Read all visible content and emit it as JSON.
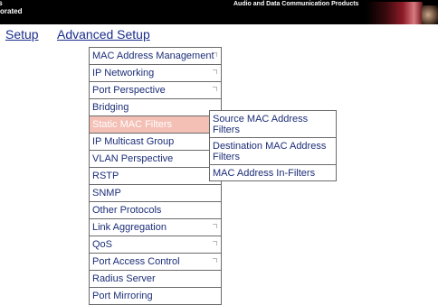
{
  "header": {
    "brand_line1": "ls",
    "brand_line2": "orated",
    "tagline": "Audio and Data Communication Products"
  },
  "nav": {
    "setup": "Setup",
    "advanced_setup": "Advanced Setup"
  },
  "menu": [
    {
      "label": "MAC Address Management",
      "has_submenu": true
    },
    {
      "label": "IP Networking",
      "has_submenu": true
    },
    {
      "label": "Port Perspective",
      "has_submenu": true
    },
    {
      "label": "Bridging",
      "has_submenu": false
    },
    {
      "label": "Static MAC Filters",
      "has_submenu": false,
      "active": true
    },
    {
      "label": "IP Multicast Group",
      "has_submenu": false
    },
    {
      "label": "VLAN Perspective",
      "has_submenu": false
    },
    {
      "label": "RSTP",
      "has_submenu": false
    },
    {
      "label": "SNMP",
      "has_submenu": false
    },
    {
      "label": "Other Protocols",
      "has_submenu": false
    },
    {
      "label": "Link Aggregation",
      "has_submenu": true
    },
    {
      "label": "QoS",
      "has_submenu": true
    },
    {
      "label": "Port Access Control",
      "has_submenu": true
    },
    {
      "label": "Radius Server",
      "has_submenu": false
    },
    {
      "label": "Port Mirroring",
      "has_submenu": false
    }
  ],
  "submenu": [
    "Source MAC Address Filters",
    "Destination MAC Address Filters",
    "MAC Address In-Filters"
  ],
  "colors": {
    "link": "#1a2d8a",
    "menu_text": "#1c2e78",
    "active_bg": "#f4bfb5",
    "border": "#6a6a6a"
  }
}
